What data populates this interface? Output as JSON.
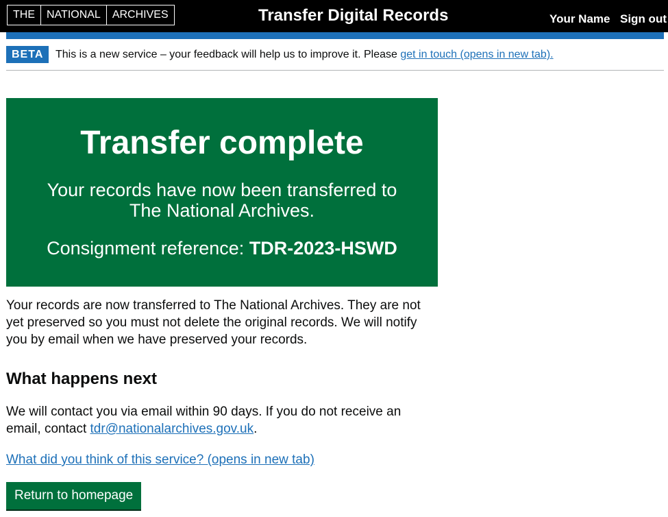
{
  "header": {
    "logo_parts": [
      "THE",
      "NATIONAL",
      "ARCHIVES"
    ],
    "service_name": "Transfer Digital Records",
    "user_name": "Your Name",
    "sign_out_label": "Sign out"
  },
  "phase_banner": {
    "tag": "BETA",
    "text": "This is a new service – your feedback will help us to improve it. Please ",
    "link_text": "get in touch (opens in new tab)."
  },
  "panel": {
    "title": "Transfer complete",
    "body": "Your records have now been transferred to The National Archives.",
    "reference_label": "Consignment reference: ",
    "reference_value": "TDR-2023-HSWD"
  },
  "content": {
    "intro": "Your records are now transferred to The National Archives. They are not yet preserved so you must not delete the original records. We will notify you by email when we have preserved your records.",
    "next_heading": "What happens next",
    "contact_text": "We will contact you via email within 90 days. If you do not receive an email, contact ",
    "contact_email": "tdr@nationalarchives.gov.uk",
    "contact_suffix": ".",
    "feedback_link": "What did you think of this service? (opens in new tab)",
    "return_button": "Return to homepage"
  },
  "colors": {
    "header_bg": "#000000",
    "accent_blue": "#1d70b8",
    "success_green": "#00703c",
    "text": "#0b0c0c"
  }
}
